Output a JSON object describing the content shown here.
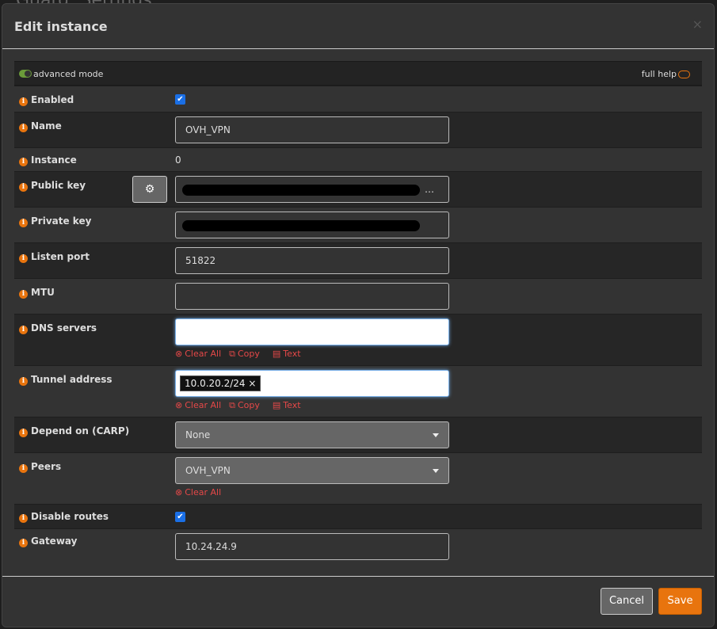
{
  "background_title": "Guard: Settings",
  "dialog": {
    "title": "Edit instance",
    "close": "×"
  },
  "advanced_mode": "advanced mode",
  "full_help": "full help",
  "fields": {
    "enabled": {
      "label": "Enabled",
      "checked": true
    },
    "name": {
      "label": "Name",
      "value": "OVH_VPN"
    },
    "instance": {
      "label": "Instance",
      "value": "0"
    },
    "public_key": {
      "label": "Public key",
      "value": "…"
    },
    "private_key": {
      "label": "Private key"
    },
    "listen_port": {
      "label": "Listen port",
      "value": "51822"
    },
    "mtu": {
      "label": "MTU",
      "value": ""
    },
    "dns_servers": {
      "label": "DNS servers",
      "value": ""
    },
    "tunnel_address": {
      "label": "Tunnel address",
      "tag": "10.0.20.2/24",
      "tag_remove": "×"
    },
    "depend_on": {
      "label": "Depend on (CARP)",
      "value": "None"
    },
    "peers": {
      "label": "Peers",
      "value": "OVH_VPN"
    },
    "disable_routes": {
      "label": "Disable routes",
      "checked": true
    },
    "gateway": {
      "label": "Gateway",
      "value": "10.24.24.9"
    }
  },
  "actions": {
    "clear_all": "Clear All",
    "copy": "Copy",
    "text": "Text"
  },
  "buttons": {
    "cancel": "Cancel",
    "save": "Save"
  },
  "colors": {
    "accent": "#e8740e",
    "checkbox": "#1a6fe6",
    "action": "#e54848"
  }
}
